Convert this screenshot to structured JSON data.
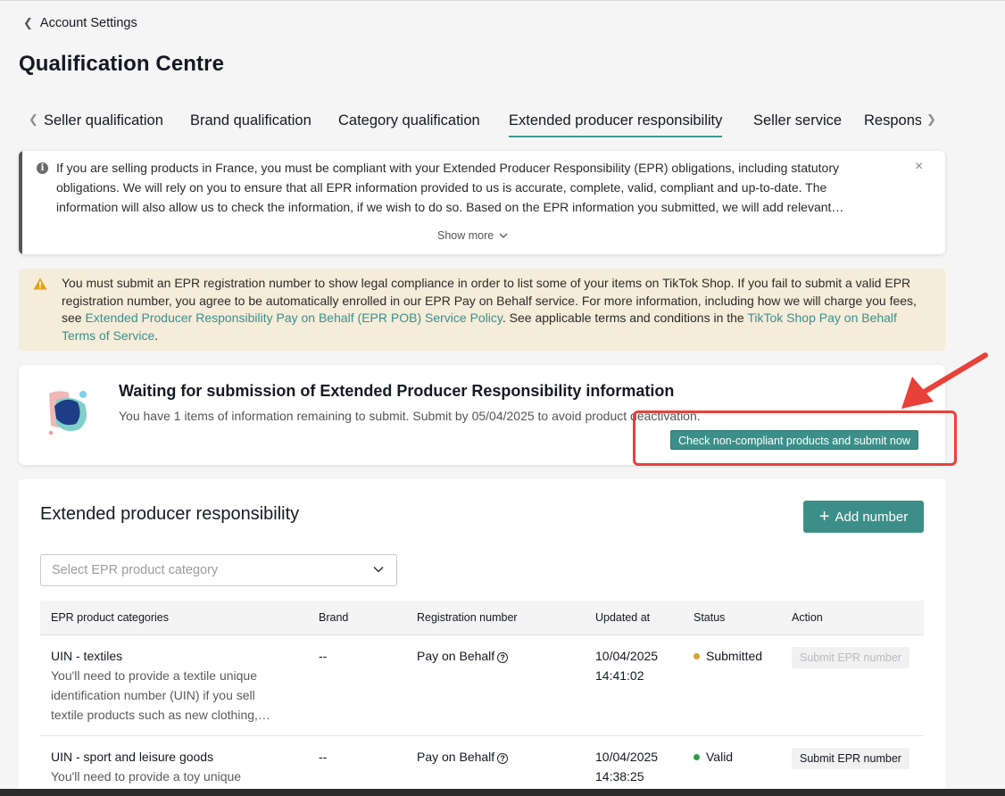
{
  "header": {
    "back_label": "Account Settings",
    "title": "Qualification Centre"
  },
  "tabs": [
    {
      "label": "Seller qualification"
    },
    {
      "label": "Brand qualification"
    },
    {
      "label": "Category qualification"
    },
    {
      "label": "Extended producer responsibility",
      "active": true
    },
    {
      "label": "Seller service"
    },
    {
      "label": "Respons"
    }
  ],
  "info_notice": {
    "text": "If you are selling products in France, you must be compliant with your Extended Producer Responsibility (EPR) obligations, including statutory obligations. We will rely on you to ensure that all EPR information provided to us is accurate, complete, valid, compliant and up-to-date. The information will also allow us to check the information, if we wish to do so. Based on the EPR information you submitted, we will add relevant…",
    "show_more": "Show more"
  },
  "warning": {
    "text_1": "You must submit an EPR registration number to show legal compliance in order to list some of your items on TikTok Shop. If you fail to submit a valid EPR registration number, you agree to be automatically enrolled in our EPR Pay on Behalf service. For more information, including how we will charge you fees, see ",
    "link_1": "Extended Producer Responsibility Pay on Behalf (EPR POB) Service Policy",
    "text_2": ". See applicable terms and conditions in the ",
    "link_2": "TikTok Shop Pay on Behalf Terms of Service",
    "text_3": "."
  },
  "waiting_card": {
    "title": "Waiting for submission of Extended Producer Responsibility information",
    "subtitle": "You have 1 items of information remaining to submit. Submit by 05/04/2025 to avoid product deactivation.",
    "button_label": "Check non-compliant products and submit now"
  },
  "epr_section": {
    "title": "Extended producer responsibility",
    "add_button_label": "Add number",
    "select_placeholder": "Select EPR product category"
  },
  "table": {
    "columns": [
      "EPR product categories",
      "Brand",
      "Registration number",
      "Updated at",
      "Status",
      "Action"
    ],
    "rows": [
      {
        "category": "UIN - textiles",
        "description": "You'll need to provide a textile unique identification number (UIN) if you sell textile products such as new clothing,…",
        "brand": "--",
        "registration": "Pay on Behalf",
        "updated_date": "10/04/2025",
        "updated_time": "14:41:02",
        "status": "Submitted",
        "status_color": "#d4a23a",
        "action": "Submit EPR number",
        "action_enabled": false
      },
      {
        "category": "UIN - sport and leisure goods",
        "description": "You'll need to provide a toy unique",
        "brand": "--",
        "registration": "Pay on Behalf",
        "updated_date": "10/04/2025",
        "updated_time": "14:38:25",
        "status": "Valid",
        "status_color": "#2e9a4a",
        "action": "Submit EPR number",
        "action_enabled": true
      }
    ]
  },
  "colors": {
    "accent": "#3c8f89",
    "warning_bg": "#f5ecd9",
    "highlight": "#e8413a"
  }
}
